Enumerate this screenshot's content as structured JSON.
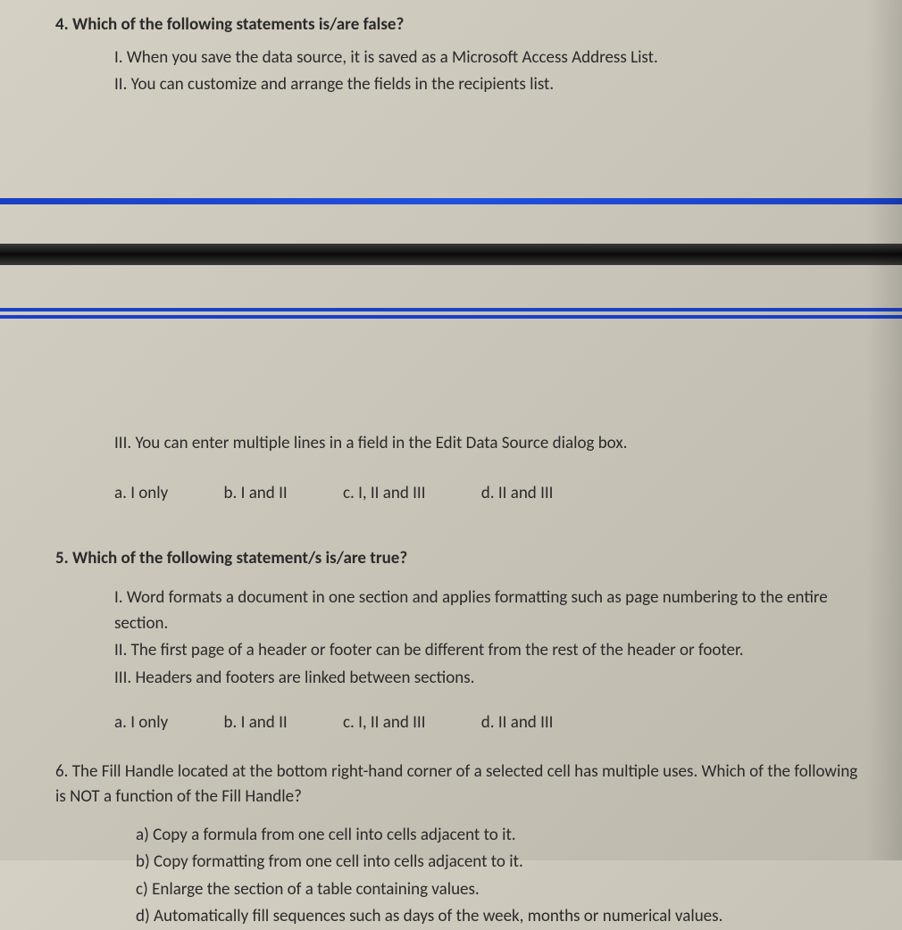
{
  "q4": {
    "prompt": "4. Which of the following statements is/are false?",
    "s1": "I. When you save the data source, it is saved as a Microsoft Access Address List.",
    "s2": "II. You can customize and arrange the fields in the recipients list.",
    "s3": "III. You can enter multiple lines in a field in the Edit Data Source dialog box.",
    "a": "a. I only",
    "b": "b. I and II",
    "c": "c. I, II and III",
    "d": "d. II and III"
  },
  "q5": {
    "prompt": "5. Which of the following statement/s is/are true?",
    "s1": "I. Word formats a document in one section and applies formatting such as page numbering to the entire section.",
    "s2": "II. The first page of a header or footer can be different from the rest of the header or footer.",
    "s3": "III. Headers and footers are linked between sections.",
    "a": "a. I only",
    "b": "b. I and II",
    "c": "c. I, II and III",
    "d": "d. II and III"
  },
  "q6": {
    "prompt": "6. The Fill Handle located at the bottom right-hand corner of a selected cell has multiple uses. Which of the following is NOT a function of the Fill Handle?",
    "a": "a) Copy a formula from one cell into cells adjacent to it.",
    "b": "b) Copy formatting from one cell into cells adjacent to it.",
    "c": "c) Enlarge the section of a table containing values.",
    "d": "d) Automatically fill sequences such as days of the week, months or numerical values."
  }
}
